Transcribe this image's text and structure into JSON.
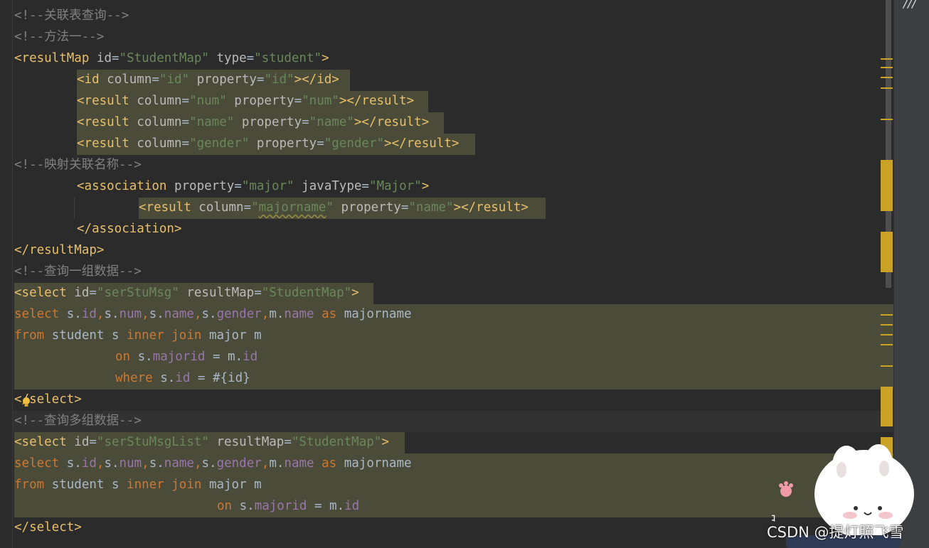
{
  "editor": {
    "language": "xml",
    "lines": [
      {
        "tokens": [
          {
            "t": "c",
            "s": "<!--关联表查询-->"
          }
        ]
      },
      {
        "tokens": [
          {
            "t": "c",
            "s": "<!--方法一-->"
          }
        ]
      },
      {
        "tokens": [
          {
            "t": "t",
            "s": "<resultMap "
          },
          {
            "t": "a",
            "s": "id"
          },
          {
            "t": "p",
            "s": "="
          },
          {
            "t": "v",
            "s": "\"StudentMap\""
          },
          {
            "t": "a",
            "s": " type"
          },
          {
            "t": "p",
            "s": "="
          },
          {
            "t": "v",
            "s": "\"student\""
          },
          {
            "t": "t",
            "s": ">"
          }
        ]
      },
      {
        "tokens": [
          {
            "t": "t",
            "s": "<id "
          },
          {
            "t": "a",
            "s": "column"
          },
          {
            "t": "p",
            "s": "="
          },
          {
            "t": "v",
            "s": "\"id\""
          },
          {
            "t": "a",
            "s": " property"
          },
          {
            "t": "p",
            "s": "="
          },
          {
            "t": "v",
            "s": "\"id\""
          },
          {
            "t": "t",
            "s": "></id>"
          }
        ]
      },
      {
        "tokens": [
          {
            "t": "t",
            "s": "<result "
          },
          {
            "t": "a",
            "s": "column"
          },
          {
            "t": "p",
            "s": "="
          },
          {
            "t": "v",
            "s": "\"num\""
          },
          {
            "t": "a",
            "s": " property"
          },
          {
            "t": "p",
            "s": "="
          },
          {
            "t": "v",
            "s": "\"num\""
          },
          {
            "t": "t",
            "s": "></result>"
          }
        ]
      },
      {
        "tokens": [
          {
            "t": "t",
            "s": "<result "
          },
          {
            "t": "a",
            "s": "column"
          },
          {
            "t": "p",
            "s": "="
          },
          {
            "t": "v",
            "s": "\"name\""
          },
          {
            "t": "a",
            "s": " property"
          },
          {
            "t": "p",
            "s": "="
          },
          {
            "t": "v",
            "s": "\"name\""
          },
          {
            "t": "t",
            "s": "></result>"
          }
        ]
      },
      {
        "tokens": [
          {
            "t": "t",
            "s": "<result "
          },
          {
            "t": "a",
            "s": "column"
          },
          {
            "t": "p",
            "s": "="
          },
          {
            "t": "v",
            "s": "\"gender\""
          },
          {
            "t": "a",
            "s": " property"
          },
          {
            "t": "p",
            "s": "="
          },
          {
            "t": "v",
            "s": "\"gender\""
          },
          {
            "t": "t",
            "s": "></result>"
          }
        ]
      },
      {
        "tokens": [
          {
            "t": "c",
            "s": "<!--映射关联名称-->"
          }
        ]
      },
      {
        "tokens": [
          {
            "t": "t",
            "s": "<association "
          },
          {
            "t": "a",
            "s": "property"
          },
          {
            "t": "p",
            "s": "="
          },
          {
            "t": "v",
            "s": "\"major\""
          },
          {
            "t": "a",
            "s": " javaType"
          },
          {
            "t": "p",
            "s": "="
          },
          {
            "t": "v",
            "s": "\"Major\""
          },
          {
            "t": "t",
            "s": ">"
          }
        ]
      },
      {
        "tokens": [
          {
            "t": "t",
            "s": "<result "
          },
          {
            "t": "a",
            "s": "column"
          },
          {
            "t": "p",
            "s": "="
          },
          {
            "t": "v",
            "s": "\""
          },
          {
            "t": "v sq",
            "s": "majorname"
          },
          {
            "t": "v",
            "s": "\""
          },
          {
            "t": "a",
            "s": " property"
          },
          {
            "t": "p",
            "s": "="
          },
          {
            "t": "v",
            "s": "\"name\""
          },
          {
            "t": "t",
            "s": "></result>"
          }
        ]
      },
      {
        "tokens": [
          {
            "t": "t",
            "s": "</association>"
          }
        ]
      },
      {
        "tokens": [
          {
            "t": "t",
            "s": "</resultMap>"
          }
        ]
      },
      {
        "tokens": [
          {
            "t": "c",
            "s": "<!--查询一组数据-->"
          }
        ]
      },
      {
        "tokens": [
          {
            "t": "t",
            "s": "<select "
          },
          {
            "t": "a",
            "s": "id"
          },
          {
            "t": "p",
            "s": "="
          },
          {
            "t": "v",
            "s": "\"serStuMsg\""
          },
          {
            "t": "a",
            "s": " resultMap"
          },
          {
            "t": "p",
            "s": "="
          },
          {
            "t": "v",
            "s": "\"StudentMap\""
          },
          {
            "t": "t",
            "s": ">"
          }
        ]
      },
      {
        "tokens": [
          {
            "t": "k",
            "s": "select "
          },
          {
            "t": "p",
            "s": "s."
          },
          {
            "t": "f",
            "s": "id"
          },
          {
            "t": "k",
            "s": ","
          },
          {
            "t": "p",
            "s": "s."
          },
          {
            "t": "f",
            "s": "num"
          },
          {
            "t": "k",
            "s": ","
          },
          {
            "t": "p",
            "s": "s."
          },
          {
            "t": "f",
            "s": "name"
          },
          {
            "t": "k",
            "s": ","
          },
          {
            "t": "p",
            "s": "s."
          },
          {
            "t": "f",
            "s": "gender"
          },
          {
            "t": "k",
            "s": ","
          },
          {
            "t": "p",
            "s": "m."
          },
          {
            "t": "f",
            "s": "name"
          },
          {
            "t": "k",
            "s": " as "
          },
          {
            "t": "p",
            "s": "majorname"
          }
        ]
      },
      {
        "tokens": [
          {
            "t": "k",
            "s": "from "
          },
          {
            "t": "p",
            "s": "student s "
          },
          {
            "t": "k",
            "s": "inner join "
          },
          {
            "t": "p",
            "s": "major m"
          }
        ]
      },
      {
        "tokens": [
          {
            "t": "k",
            "s": "on "
          },
          {
            "t": "p",
            "s": "s."
          },
          {
            "t": "f",
            "s": "majorid"
          },
          {
            "t": "p",
            "s": " = m."
          },
          {
            "t": "f",
            "s": "id"
          }
        ]
      },
      {
        "tokens": [
          {
            "t": "k",
            "s": "where "
          },
          {
            "t": "p",
            "s": "s."
          },
          {
            "t": "f",
            "s": "id"
          },
          {
            "t": "p",
            "s": " = #{id}"
          }
        ]
      },
      {
        "tokens": [
          {
            "t": "t",
            "s": "</select>"
          }
        ]
      },
      {
        "tokens": [
          {
            "t": "c",
            "s": "<!--查询多组数据-->"
          }
        ]
      },
      {
        "tokens": [
          {
            "t": "t",
            "s": "<select "
          },
          {
            "t": "a",
            "s": "id"
          },
          {
            "t": "p",
            "s": "="
          },
          {
            "t": "v",
            "s": "\"serStuMsgList\""
          },
          {
            "t": "a",
            "s": " resultMap"
          },
          {
            "t": "p",
            "s": "="
          },
          {
            "t": "v",
            "s": "\"StudentMap\""
          },
          {
            "t": "t",
            "s": ">"
          }
        ]
      },
      {
        "tokens": [
          {
            "t": "k",
            "s": "select "
          },
          {
            "t": "p",
            "s": "s."
          },
          {
            "t": "f",
            "s": "id"
          },
          {
            "t": "k",
            "s": ","
          },
          {
            "t": "p",
            "s": "s."
          },
          {
            "t": "f",
            "s": "num"
          },
          {
            "t": "k",
            "s": ","
          },
          {
            "t": "p",
            "s": "s."
          },
          {
            "t": "f",
            "s": "name"
          },
          {
            "t": "k",
            "s": ","
          },
          {
            "t": "p",
            "s": "s."
          },
          {
            "t": "f",
            "s": "gender"
          },
          {
            "t": "k",
            "s": ","
          },
          {
            "t": "p",
            "s": "m."
          },
          {
            "t": "f",
            "s": "name"
          },
          {
            "t": "k",
            "s": " as "
          },
          {
            "t": "p",
            "s": "majorname"
          }
        ]
      },
      {
        "tokens": [
          {
            "t": "k",
            "s": "from "
          },
          {
            "t": "p",
            "s": "student s "
          },
          {
            "t": "k",
            "s": "inner join "
          },
          {
            "t": "p",
            "s": "major m"
          }
        ]
      },
      {
        "tokens": [
          {
            "t": "k",
            "s": "on "
          },
          {
            "t": "p",
            "s": "s."
          },
          {
            "t": "f",
            "s": "majorid"
          },
          {
            "t": "p",
            "s": " = m."
          },
          {
            "t": "f",
            "s": "id"
          }
        ]
      },
      {
        "tokens": [
          {
            "t": "t",
            "s": "</select>"
          }
        ]
      }
    ]
  },
  "colors": {
    "background": "#2b2b2b",
    "comment": "#808080",
    "tag": "#e8bf6a",
    "attribute": "#bababa",
    "value": "#6a8759",
    "keyword": "#cc7832",
    "field": "#9876aa",
    "plain": "#a9b7c6",
    "highlight": "#4b4b3a",
    "marker": "#c9a227"
  },
  "icons": {
    "lightbulb": "lightbulb-icon",
    "panel_glyph": "///",
    "sticker": "bunny-sticker",
    "sticker_paw": "paw-icon",
    "sticker_badge": "中"
  },
  "watermark": {
    "text": "CSDN @提灯照飞雪"
  }
}
